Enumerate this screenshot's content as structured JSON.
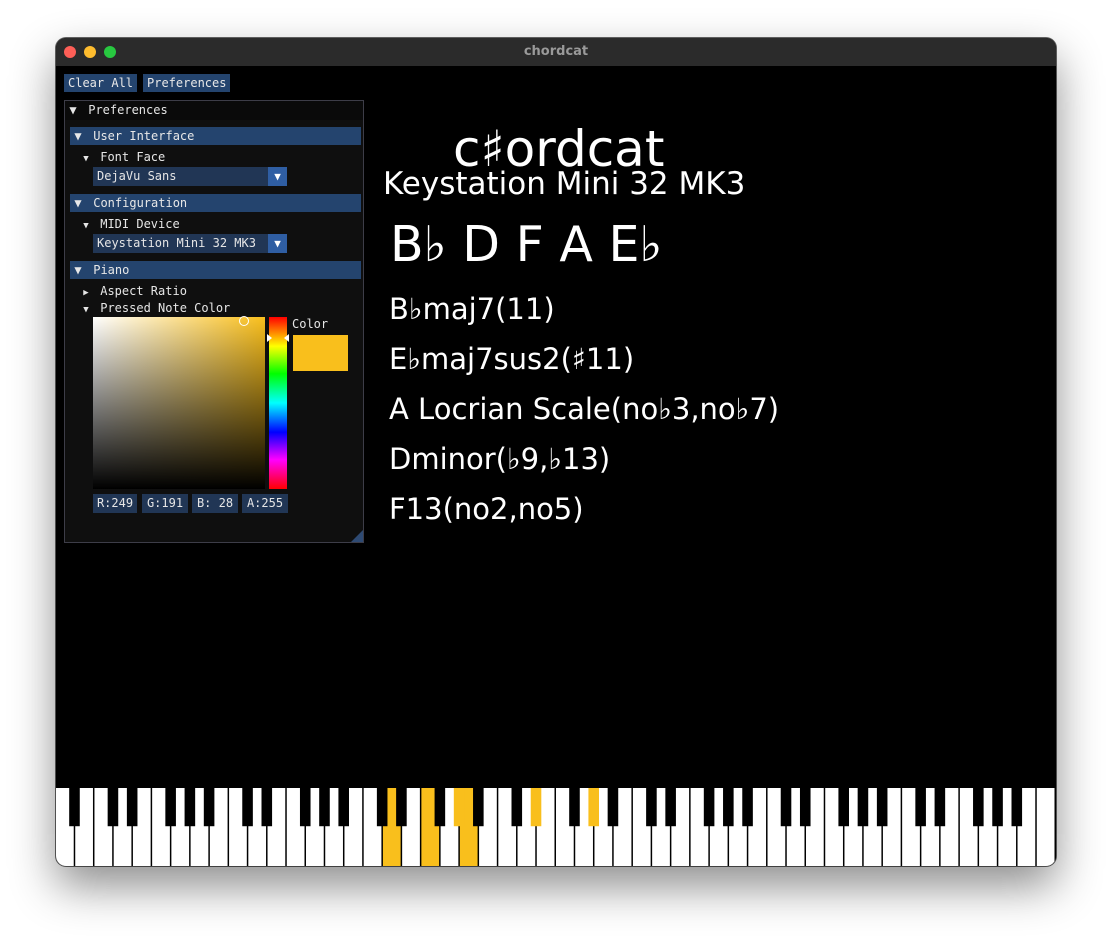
{
  "window": {
    "title": "chordcat"
  },
  "toolbar": {
    "clear_all": "Clear All",
    "preferences": "Preferences"
  },
  "prefs": {
    "title": "Preferences",
    "user_interface": {
      "header": "User Interface",
      "font_face_label": "Font Face",
      "font_face_value": "DejaVu Sans"
    },
    "configuration": {
      "header": "Configuration",
      "midi_device_label": "MIDI Device",
      "midi_device_value": "Keystation Mini 32 MK3"
    },
    "piano": {
      "header": "Piano",
      "aspect_ratio_label": "Aspect Ratio",
      "pressed_note_color_label": "Pressed Note Color",
      "color_label": "Color",
      "channels": {
        "r": "R:249",
        "g": "G:191",
        "b": "B: 28",
        "a": "A:255"
      }
    }
  },
  "main": {
    "logo": "c♯ordcat",
    "device": "Keystation Mini 32 MK3",
    "notes": "B♭ D F A E♭",
    "chords": [
      "B♭maj7(11)",
      "E♭maj7sus2(♯11)",
      "A Locrian Scale(no♭3,no♭7)",
      "Dminor(♭9,♭13)",
      "F13(no2,no5)"
    ]
  },
  "colors": {
    "accent": "#24446e",
    "pressed": "#f9bf1c"
  },
  "piano": {
    "white_keys": 52,
    "pressed_white_indices": [
      17,
      19,
      21
    ],
    "pressed_black_indices": [
      14,
      17,
      19
    ]
  }
}
